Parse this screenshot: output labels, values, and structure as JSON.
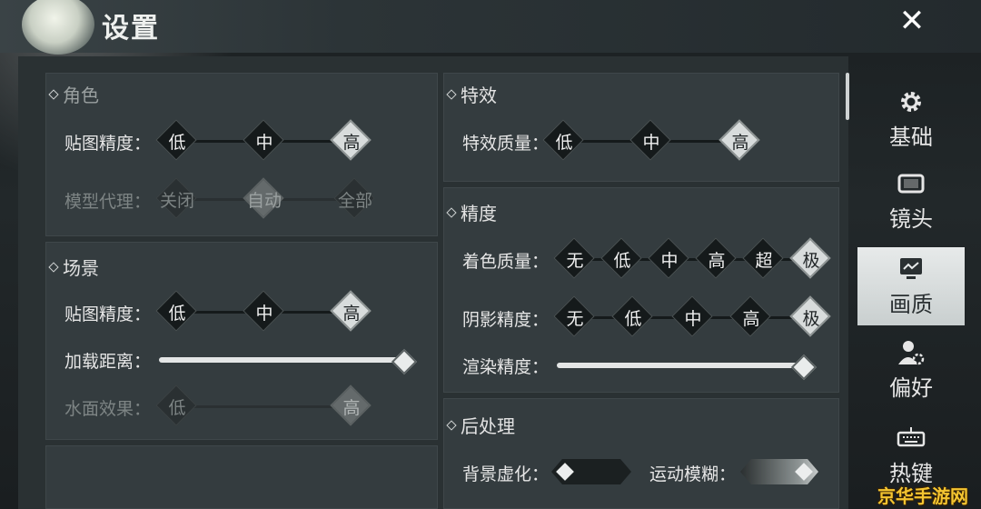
{
  "window": {
    "title": "设置",
    "close_glyph": "✕"
  },
  "sidebar": {
    "items": [
      {
        "label": "基础",
        "icon": "gear-icon",
        "active": false
      },
      {
        "label": "镜头",
        "icon": "camera-frame-icon",
        "active": false
      },
      {
        "label": "画质",
        "icon": "monitor-icon",
        "active": true
      },
      {
        "label": "偏好",
        "icon": "user-gear-icon",
        "active": false
      },
      {
        "label": "热键",
        "icon": "keyboard-icon",
        "active": false
      }
    ]
  },
  "character": {
    "title": "角色",
    "texture_label": "贴图精度：",
    "texture_options": [
      "低",
      "中",
      "高"
    ],
    "texture_selected": "高",
    "model_proxy_label": "模型代理：",
    "model_proxy_options": [
      "关闭",
      "自动",
      "全部"
    ],
    "model_proxy_selected": "自动"
  },
  "scene": {
    "title": "场景",
    "texture_label": "贴图精度：",
    "texture_options": [
      "低",
      "中",
      "高"
    ],
    "texture_selected": "高",
    "load_distance_label": "加载距离：",
    "load_distance_level": 1.0,
    "water_label": "水面效果：",
    "water_options": [
      "低",
      "高"
    ],
    "water_selected": "高"
  },
  "effects": {
    "title": "特效",
    "quality_label": "特效质量：",
    "quality_options": [
      "低",
      "中",
      "高"
    ],
    "quality_selected": "高"
  },
  "precision": {
    "title": "精度",
    "shading_label": "着色质量：",
    "shading_options": [
      "无",
      "低",
      "中",
      "高",
      "超",
      "极"
    ],
    "shading_selected": "极",
    "shadow_label": "阴影精度：",
    "shadow_options": [
      "无",
      "低",
      "中",
      "高",
      "极"
    ],
    "shadow_selected": "极",
    "render_label": "渲染精度：",
    "render_level": 1.0
  },
  "postprocess": {
    "title": "后处理",
    "bg_blur_label": "背景虚化：",
    "bg_blur_on": false,
    "motion_blur_label": "运动模糊：",
    "motion_blur_on": true
  },
  "watermark": "京华手游网"
}
